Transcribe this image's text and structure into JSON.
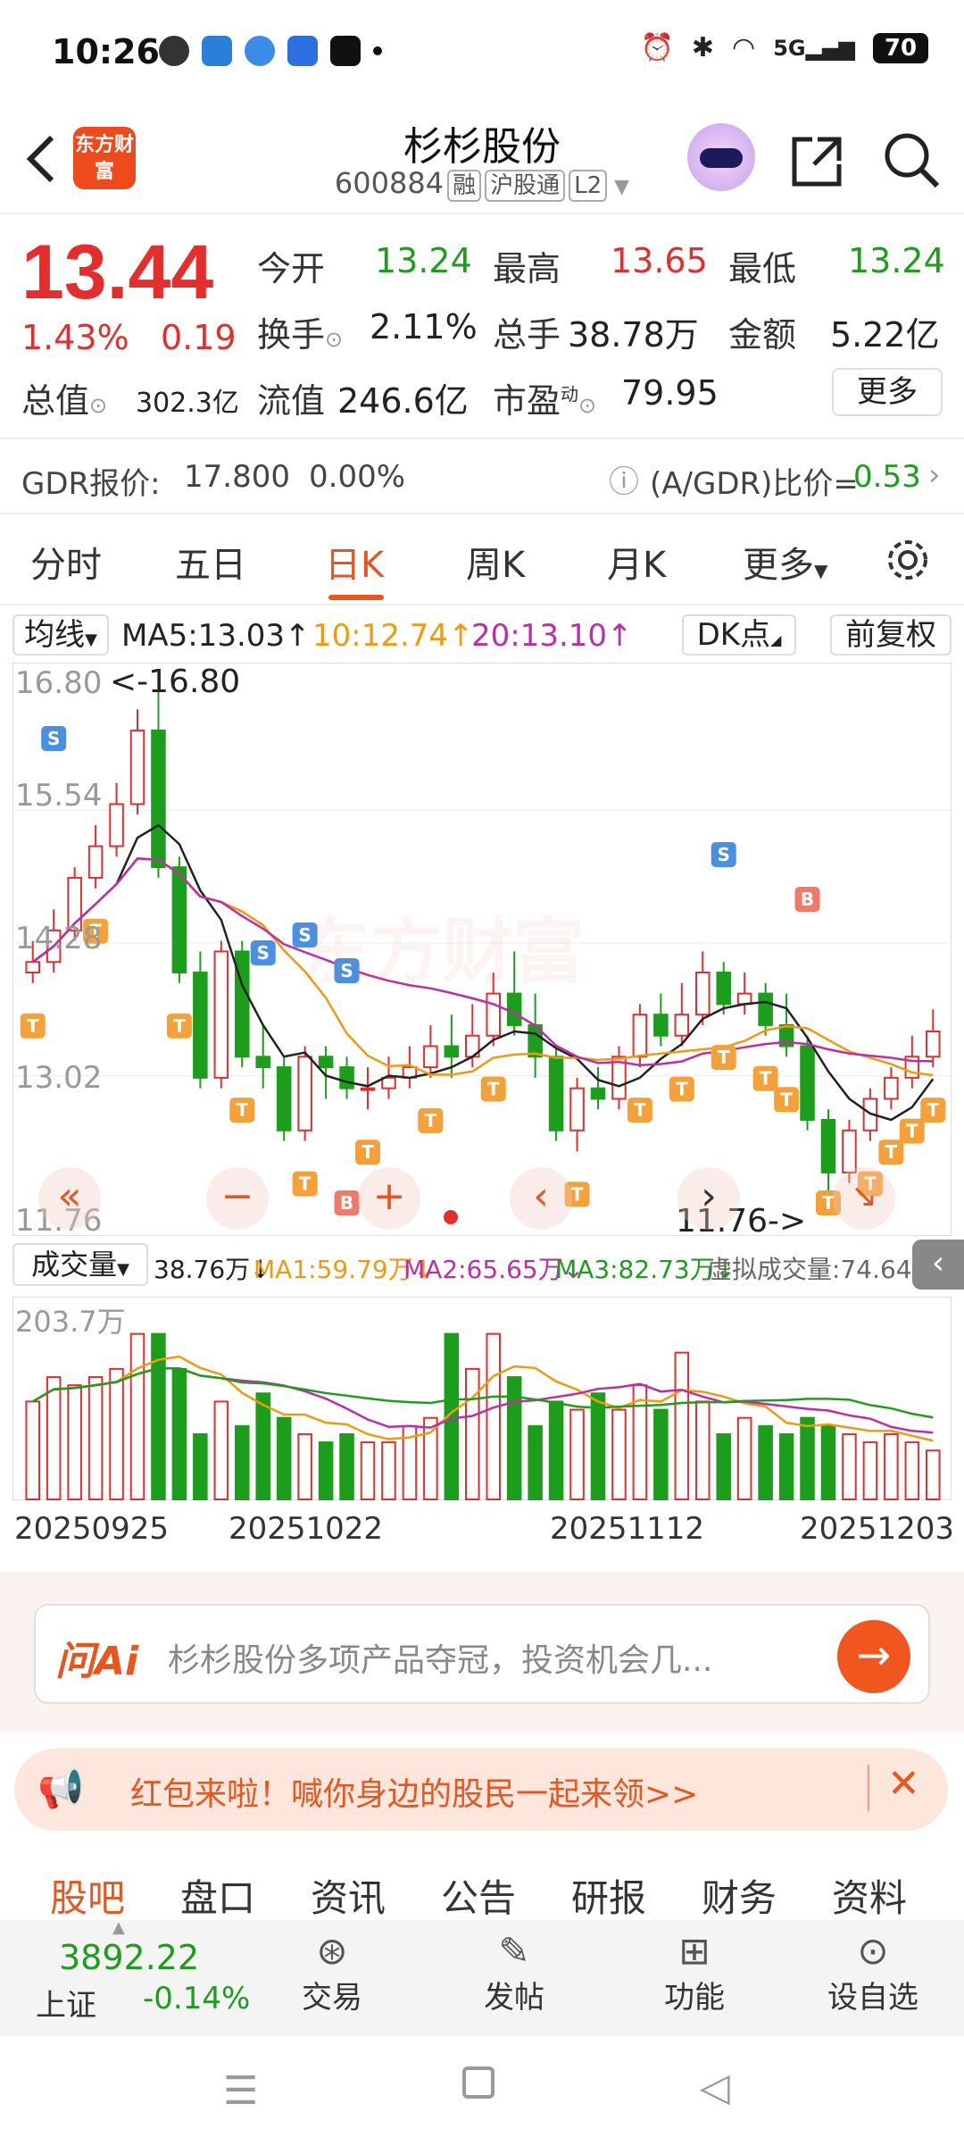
{
  "status": {
    "time": "10:26",
    "battery": "70",
    "net": "5G"
  },
  "header": {
    "logo": "东方财富",
    "title": "杉杉股份",
    "code": "600884",
    "tags": [
      "融",
      "沪股通",
      "L2"
    ]
  },
  "quote": {
    "price": "13.44",
    "change_pct": "1.43%",
    "change": "0.19",
    "open_label": "今开",
    "open": "13.24",
    "high_label": "最高",
    "high": "13.65",
    "low_label": "最低",
    "low": "13.24",
    "turnover_label": "换手",
    "turnover": "2.11%",
    "volume_label": "总手",
    "volume": "38.78万",
    "amount_label": "金额",
    "amount": "5.22亿",
    "mcap_label": "总值",
    "mcap": "302.3亿",
    "float_label": "流值",
    "float": "246.6亿",
    "pe_label": "市盈",
    "pe_sup": "动",
    "pe": "79.95",
    "more": "更多"
  },
  "gdr": {
    "label": "GDR报价:",
    "price": "17.800",
    "pct": "0.00%",
    "ratio_label": "(A/GDR)比价=",
    "ratio": "0.53"
  },
  "tabs": [
    "分时",
    "五日",
    "日K",
    "周K",
    "月K",
    "更多"
  ],
  "ma_legend": {
    "select": "均线",
    "ma5": "MA5:13.03↑",
    "ma10": "10:12.74↑",
    "ma20": "20:13.10↑",
    "dk": "DK点",
    "adj": "前复权"
  },
  "kchart": {
    "y_labels": [
      "16.80",
      "15.54",
      "14.28",
      "13.02",
      "11.76"
    ],
    "max_label": "<-16.80",
    "min_label": "11.76->",
    "watermark": "东方财富",
    "markers": {
      "S": "S",
      "T": "T",
      "B": "B"
    }
  },
  "vol_legend": {
    "select": "成交量",
    "v": "38.76万↓",
    "ma1": "MA1:59.79万↓",
    "ma2": "MA2:65.65万↓",
    "ma3": "MA3:82.73万↓",
    "virtual": "虚拟成交量:74.64万"
  },
  "vchart": {
    "max_label": "203.7万"
  },
  "dates": [
    "20250925",
    "20251022",
    "20251112",
    "20251203"
  ],
  "ai": {
    "logo": "问Ai",
    "prompt": "杉杉股份多项产品夺冠，投资机会几..."
  },
  "promo": {
    "text": "红包来啦！喊你身边的股民一起来领>>"
  },
  "bottom_tabs": [
    "股吧",
    "盘口",
    "资讯",
    "公告",
    "研报",
    "财务",
    "资料"
  ],
  "footer": {
    "index_value": "3892.22",
    "index_name": "上证",
    "index_pct": "-0.14%",
    "trade": "交易",
    "post": "发帖",
    "func": "功能",
    "watch": "设自选"
  },
  "colors": {
    "up": "#e42d2d",
    "down": "#1c9e1c",
    "accent": "#e8561e"
  }
}
